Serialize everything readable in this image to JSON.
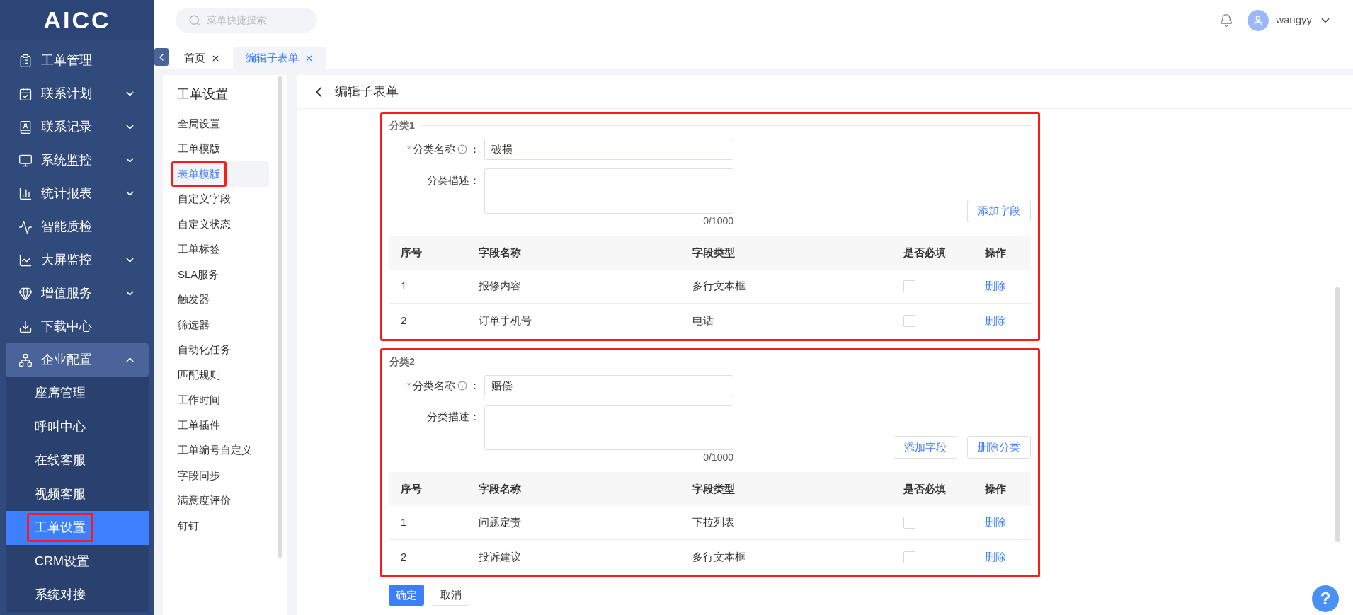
{
  "sidebar": {
    "logo": "AICC",
    "items": [
      {
        "kind": "link",
        "label": "工单管理"
      },
      {
        "kind": "group",
        "label": "联系计划",
        "expanded": false
      },
      {
        "kind": "group",
        "label": "联系记录",
        "expanded": false
      },
      {
        "kind": "group",
        "label": "系统监控",
        "expanded": false
      },
      {
        "kind": "group",
        "label": "统计报表",
        "expanded": false
      },
      {
        "kind": "link",
        "label": "智能质检"
      },
      {
        "kind": "group",
        "label": "大屏监控",
        "expanded": false
      },
      {
        "kind": "group",
        "label": "增值服务",
        "expanded": false
      },
      {
        "kind": "link",
        "label": "下载中心"
      },
      {
        "kind": "group",
        "label": "企业配置",
        "expanded": true,
        "children": [
          {
            "label": "座席管理",
            "selected": false,
            "highlighted": false
          },
          {
            "label": "呼叫中心",
            "selected": false,
            "highlighted": false
          },
          {
            "label": "在线客服",
            "selected": false,
            "highlighted": false
          },
          {
            "label": "视频客服",
            "selected": false,
            "highlighted": false
          },
          {
            "label": "工单设置",
            "selected": true,
            "highlighted": true
          },
          {
            "label": "CRM设置",
            "selected": false,
            "highlighted": false
          },
          {
            "label": "系统对接",
            "selected": false,
            "highlighted": false
          }
        ]
      }
    ]
  },
  "header": {
    "search_placeholder": "菜单快捷搜索",
    "username": "wangyy"
  },
  "tabs": [
    {
      "label": "首页",
      "selected": false
    },
    {
      "label": "编辑子表单",
      "selected": true
    }
  ],
  "submenu": {
    "title": "工单设置",
    "items": [
      {
        "label": "全局设置",
        "selected": false,
        "highlighted": false
      },
      {
        "label": "工单模版",
        "selected": false,
        "highlighted": false
      },
      {
        "label": "表单模版",
        "selected": true,
        "highlighted": true
      },
      {
        "label": "自定义字段",
        "selected": false,
        "highlighted": false
      },
      {
        "label": "自定义状态",
        "selected": false,
        "highlighted": false
      },
      {
        "label": "工单标签",
        "selected": false,
        "highlighted": false
      },
      {
        "label": "SLA服务",
        "selected": false,
        "highlighted": false
      },
      {
        "label": "触发器",
        "selected": false,
        "highlighted": false
      },
      {
        "label": "筛选器",
        "selected": false,
        "highlighted": false
      },
      {
        "label": "自动化任务",
        "selected": false,
        "highlighted": false
      },
      {
        "label": "匹配规则",
        "selected": false,
        "highlighted": false
      },
      {
        "label": "工作时间",
        "selected": false,
        "highlighted": false
      },
      {
        "label": "工单插件",
        "selected": false,
        "highlighted": false
      },
      {
        "label": "工单编号自定义",
        "selected": false,
        "highlighted": false
      },
      {
        "label": "字段同步",
        "selected": false,
        "highlighted": false
      },
      {
        "label": "满意度评价",
        "selected": false,
        "highlighted": false
      },
      {
        "label": "钉钉",
        "selected": false,
        "highlighted": false
      }
    ]
  },
  "page": {
    "title": "编辑子表单",
    "categories": [
      {
        "title": "分类1",
        "highlighted": true,
        "name_label": "分类名称",
        "required_mark": "*",
        "colon": "：",
        "name_value": "破损",
        "desc_label": "分类描述：",
        "counter": "0/1000",
        "buttons": [
          "添加字段"
        ],
        "columns": [
          "序号",
          "字段名称",
          "字段类型",
          "是否必填",
          "操作"
        ],
        "rows": [
          {
            "index": "1",
            "name": "报修内容",
            "type": "多行文本框",
            "required": false,
            "action": "删除"
          },
          {
            "index": "2",
            "name": "订单手机号",
            "type": "电话",
            "required": false,
            "action": "删除"
          }
        ]
      },
      {
        "title": "分类2",
        "highlighted": true,
        "name_label": "分类名称",
        "required_mark": "*",
        "colon": "：",
        "name_value": "赔偿",
        "desc_label": "分类描述：",
        "counter": "0/1000",
        "buttons": [
          "添加字段",
          "删除分类"
        ],
        "columns": [
          "序号",
          "字段名称",
          "字段类型",
          "是否必填",
          "操作"
        ],
        "rows": [
          {
            "index": "1",
            "name": "问题定责",
            "type": "下拉列表",
            "required": false,
            "action": "删除"
          },
          {
            "index": "2",
            "name": "投诉建议",
            "type": "多行文本框",
            "required": false,
            "action": "删除"
          }
        ]
      }
    ],
    "footer_buttons": [
      {
        "label": "确定",
        "kind": "primary"
      },
      {
        "label": "取消",
        "kind": "default"
      }
    ]
  },
  "help": "?"
}
